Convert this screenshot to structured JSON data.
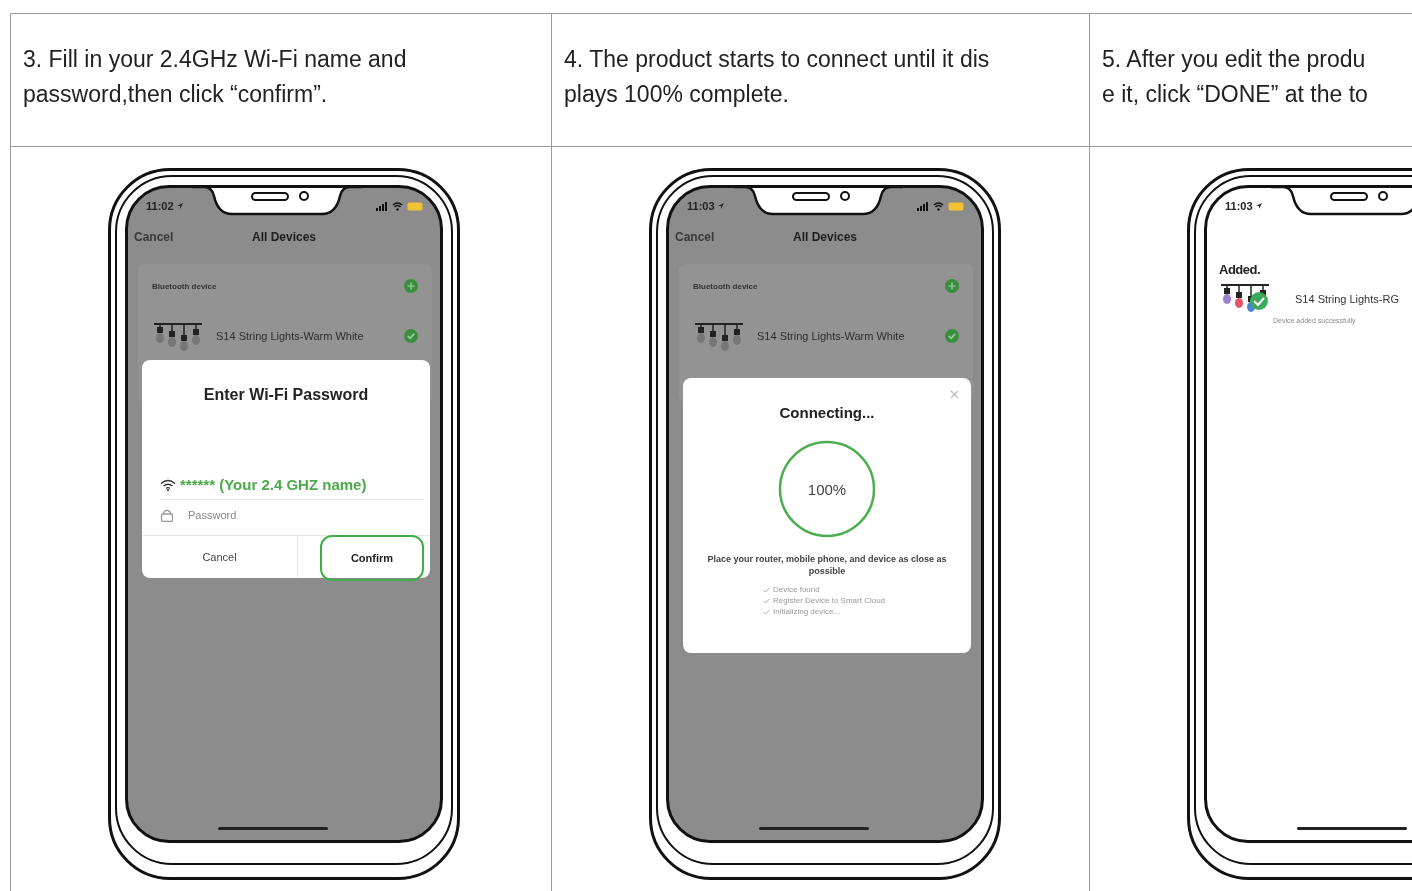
{
  "steps": [
    {
      "instruction": [
        "3. Fill in your 2.4GHz Wi-Fi name and",
        "password,then click “confirm”."
      ],
      "phone": {
        "time": "11:02",
        "screen": {
          "kind": "list",
          "nav": {
            "left": "Cancel",
            "title": "All Devices"
          },
          "section": "Bluetooth device",
          "device": {
            "name": "S14 String Lights-Warm White",
            "added": true
          },
          "dialog": {
            "kind": "wifi",
            "title": "Enter Wi-Fi Password",
            "network": "****** (Your 2.4 GHZ name)",
            "password_placeholder": "Password",
            "buttons": [
              {
                "label": "Cancel",
                "highlighted": false
              },
              {
                "label": "Confirm",
                "highlighted": true
              }
            ]
          }
        }
      }
    },
    {
      "instruction": [
        "4. The product starts to connect until it dis",
        "plays 100% complete."
      ],
      "phone": {
        "time": "11:03",
        "screen": {
          "kind": "list",
          "nav": {
            "left": "Cancel",
            "title": "All Devices"
          },
          "section": "Bluetooth device",
          "device": {
            "name": "S14 String Lights-Warm White",
            "added": true
          },
          "dialog": {
            "kind": "progress",
            "title": "Connecting...",
            "reading": "100%",
            "level": 1,
            "note": "Place your router, mobile phone, and device as close as possible",
            "checklist": [
              "Device found",
              "Register Device to Smart Cloud",
              "Initializing device..."
            ]
          }
        }
      }
    },
    {
      "instruction": [
        "5. After you edit the produ",
        "e it, click “DONE” at the to"
      ],
      "phone": {
        "time": "11:03",
        "screen": {
          "kind": "added",
          "heading": "Added.",
          "device": {
            "name": "S14 String Lights-RG",
            "status": "Device added successfully"
          }
        }
      }
    }
  ]
}
